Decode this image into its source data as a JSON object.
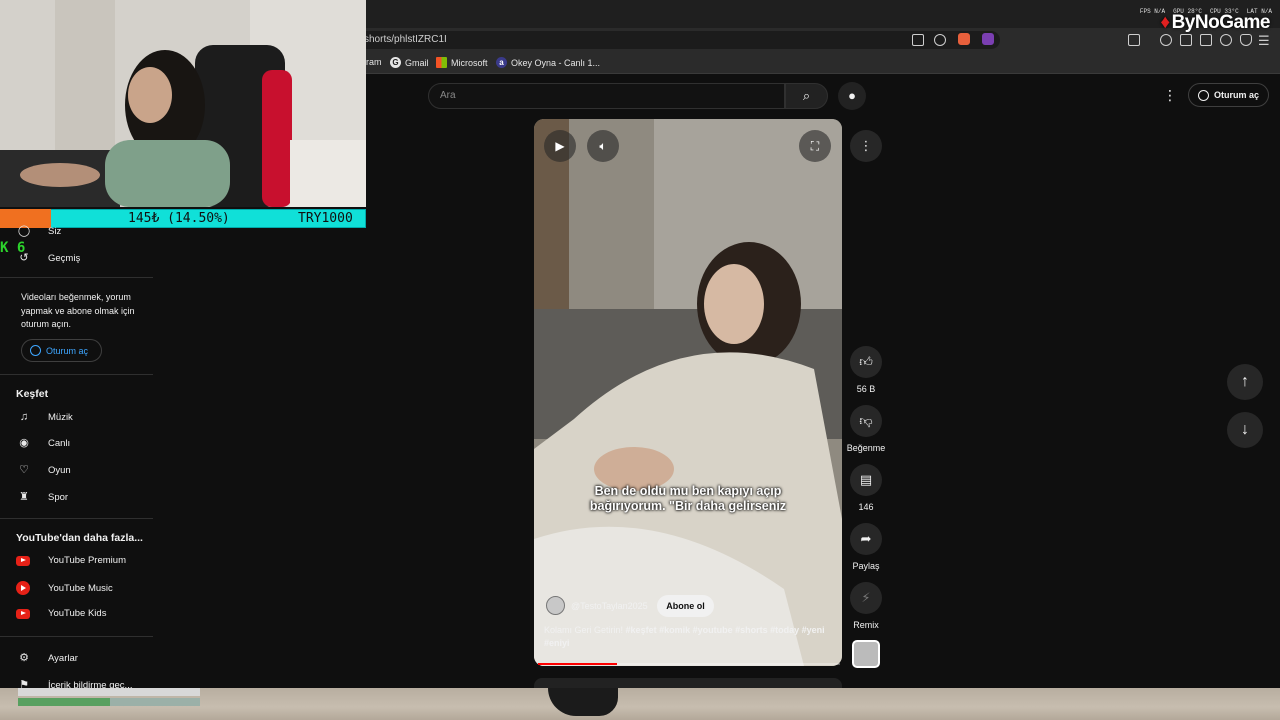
{
  "overlay": {
    "fps_label": "FPS",
    "fps_value": "N/A",
    "gpu_label": "GPU",
    "gpu_value": "28°C",
    "cpu_label": "CPU",
    "cpu_value": "33°C",
    "lat_label": "LAT",
    "lat_value": "N/A",
    "brand": "ByNoGame"
  },
  "browser": {
    "url": "shorts/phlstIZRC1I",
    "bookmarks": [
      {
        "label": "ram",
        "icon": "instagram-icon"
      },
      {
        "label": "Gmail",
        "icon": "google-icon"
      },
      {
        "label": "Microsoft",
        "icon": "microsoft-icon"
      },
      {
        "label": "Okey Oyna - Canlı 1...",
        "icon": "okey-icon"
      }
    ]
  },
  "stream": {
    "donation_text": "145₺ (14.50%)",
    "donation_goal": "TRY1000",
    "donation_progress": 0.145,
    "tag": "K 6"
  },
  "header": {
    "search_placeholder": "Ara",
    "signin_label": "Oturum aç"
  },
  "sidebar": {
    "you_label": "Siz",
    "history_label": "Geçmiş",
    "signin_message": "Videoları beğenmek, yorum yapmak ve abone olmak için oturum açın.",
    "signin_button": "Oturum aç",
    "explore_title": "Keşfet",
    "explore_items": [
      {
        "label": "Müzik",
        "icon": "music-note-icon"
      },
      {
        "label": "Canlı",
        "icon": "live-broadcast-icon"
      },
      {
        "label": "Oyun",
        "icon": "gamepad-icon"
      },
      {
        "label": "Spor",
        "icon": "trophy-icon"
      }
    ],
    "more_title": "YouTube'dan daha fazla...",
    "more_items": [
      {
        "label": "YouTube Premium",
        "icon": "youtube-premium-icon"
      },
      {
        "label": "YouTube Music",
        "icon": "youtube-music-icon"
      },
      {
        "label": "YouTube Kids",
        "icon": "youtube-kids-icon"
      }
    ],
    "settings_label": "Ayarlar",
    "report_label": "İçerik bildirme geç..."
  },
  "short": {
    "subtitle_line1": "Ben de oldu mu ben kapıyı açıp",
    "subtitle_line2": "bağırıyorum. \"Bir daha gelirseniz",
    "channel": "@TestoTaylan2025",
    "subscribe_label": "Abone ol",
    "caption_text": "Kolamı Geri Getirin!",
    "caption_tags": "#keşfet #komik #youtube #shorts #today #yeni #eniyi",
    "progress": 0.26
  },
  "actions": {
    "like_count": "56 B",
    "dislike_label": "Beğenme",
    "comment_count": "146",
    "share_label": "Paylaş",
    "remix_label": "Remix"
  },
  "colors": {
    "accent_blue": "#3ea6ff",
    "youtube_red": "#e62117",
    "donation_cyan": "#10e0d8",
    "donation_orange": "#f07020",
    "stream_green": "#2cd42c"
  }
}
